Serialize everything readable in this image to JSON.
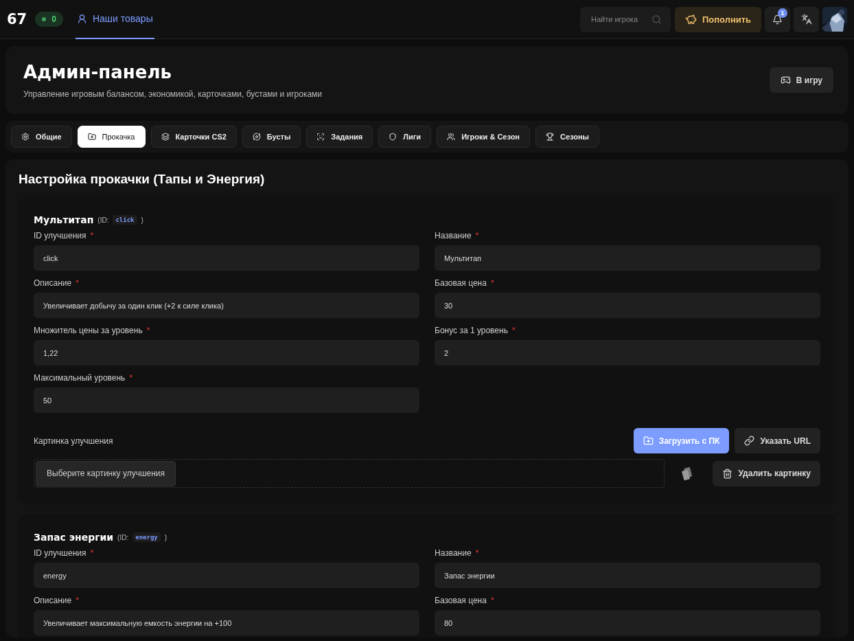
{
  "topbar": {
    "logo": "67",
    "online_badge": "0",
    "nav": [
      {
        "label": "Наши товары",
        "selected": true
      }
    ],
    "search": {
      "placeholder": "Найти игрока"
    },
    "topup_button": "Пополнить",
    "notifications_count": "1"
  },
  "header": {
    "title": "Админ-панель",
    "subtitle": "Управление игровым балансом, экономикой, карточками, бустами и игроками",
    "play_button": "В игру"
  },
  "tabs": [
    {
      "label": "Общие",
      "selected": false
    },
    {
      "label": "Прокачка",
      "selected": true
    },
    {
      "label": "Карточки CS2",
      "selected": false
    },
    {
      "label": "Бусты",
      "selected": false
    },
    {
      "label": "Задания",
      "selected": false
    },
    {
      "label": "Лиги",
      "selected": false
    },
    {
      "label": "Игроки & Сезон",
      "selected": false
    },
    {
      "label": "Сезоны",
      "selected": false
    }
  ],
  "section_title": "Настройка прокачки (Тапы и Энергия)",
  "upgrades": [
    {
      "name": "Мультитап",
      "id_prefix": "(ID:",
      "id": "click",
      "id_suffix": ")",
      "fields": [
        {
          "label": "ID улучшения",
          "required_mark": "*",
          "value": "click"
        },
        {
          "label": "Название",
          "required_mark": "*",
          "value": "Мультитап"
        },
        {
          "label": "Описание",
          "required_mark": "*",
          "value": "Увеличивает добычу за один клик (+2 к силе клика)"
        },
        {
          "label": "Базовая цена",
          "required_mark": "*",
          "value": "30"
        },
        {
          "label": "Множитель цены за уровень",
          "required_mark": "*",
          "value": "1,22"
        },
        {
          "label": "Бонус за 1 уровень",
          "required_mark": "*",
          "value": "2"
        },
        {
          "label": "Максимальный уровень",
          "required_mark": "*",
          "value": "50"
        }
      ],
      "image": {
        "label": "Картинка улучшения",
        "upload_button": "Загрузить с ПК",
        "url_button": "Указать URL",
        "choose_button": "Выберите картинку улучшения",
        "delete_button": "Удалить картинку"
      }
    },
    {
      "name": "Запас энергии",
      "id_prefix": "(ID:",
      "id": "energy",
      "id_suffix": ")",
      "fields": [
        {
          "label": "ID улучшения",
          "required_mark": "*",
          "value": "energy"
        },
        {
          "label": "Название",
          "required_mark": "*",
          "value": "Запас энергии"
        },
        {
          "label": "Описание",
          "required_mark": "*",
          "value": "Увеличивает максимальную емкость энергии на +100"
        },
        {
          "label": "Базовая цена",
          "required_mark": "*",
          "value": "80"
        }
      ]
    }
  ]
}
